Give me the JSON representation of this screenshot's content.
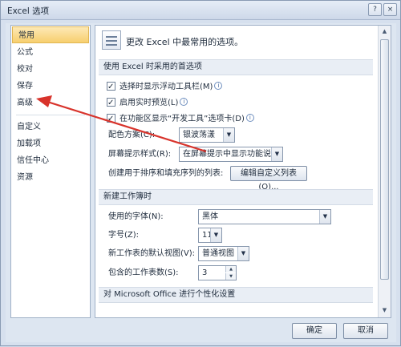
{
  "window": {
    "title": "Excel 选项",
    "help_icon": "?",
    "close_icon": "×"
  },
  "sidebar": {
    "items": [
      {
        "label": "常用"
      },
      {
        "label": "公式"
      },
      {
        "label": "校对"
      },
      {
        "label": "保存"
      },
      {
        "label": "高级"
      },
      {
        "label": "自定义"
      },
      {
        "label": "加载项"
      },
      {
        "label": "信任中心"
      },
      {
        "label": "资源"
      }
    ]
  },
  "header": {
    "text": "更改 Excel 中最常用的选项。"
  },
  "section1": {
    "title": "使用 Excel 时采用的首选项",
    "opt1": "选择时显示浮动工具栏(M)",
    "opt2": "启用实时预览(L)",
    "opt3": "在功能区显示“开发工具”选项卡(D)",
    "color_label": "配色方案(C):",
    "color_value": "银波荡漾",
    "tip_label": "屏幕提示样式(R):",
    "tip_value": "在屏幕提示中显示功能说明",
    "list_label": "创建用于排序和填充序列的列表:",
    "list_button": "编辑自定义列表(O)..."
  },
  "section2": {
    "title": "新建工作簿时",
    "font_label": "使用的字体(N):",
    "font_value": "黑体",
    "size_label": "字号(Z):",
    "size_value": "11",
    "view_label": "新工作表的默认视图(V):",
    "view_value": "普通视图",
    "sheets_label": "包含的工作表数(S):",
    "sheets_value": "3"
  },
  "section3": {
    "title": "对 Microsoft Office 进行个性化设置"
  },
  "footer": {
    "ok": "确定",
    "cancel": "取消"
  },
  "colors": {
    "annotation_arrow": "#d8332b",
    "active_nav": "#f7cf6e"
  }
}
